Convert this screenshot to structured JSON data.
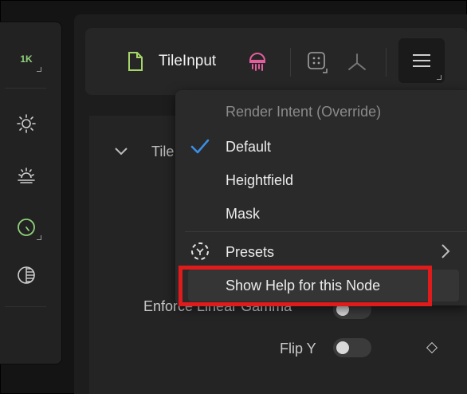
{
  "left_toolbar": {
    "resolution_badge": "1K",
    "tools": [
      "sun-icon",
      "sunrise-icon",
      "color-picker-icon",
      "half-circle-icon"
    ]
  },
  "node_header": {
    "title": "TileInput",
    "node_icon_color": "#a6d66a",
    "render_icon_color": "#e35d9d"
  },
  "section": {
    "title": "Tile",
    "props": [
      {
        "label": "Enforce Linear Gamma",
        "value": "off"
      },
      {
        "label": "Flip Y",
        "value": "off"
      }
    ]
  },
  "dropdown": {
    "heading": "Render Intent (Override)",
    "items": [
      {
        "label": "Default",
        "checked": true
      },
      {
        "label": "Heightfield",
        "checked": false
      },
      {
        "label": "Mask",
        "checked": false
      }
    ],
    "presets_label": "Presets",
    "help_label": "Show Help for this Node",
    "check_color": "#3b8fe6",
    "highlight_color": "#e01b1b"
  }
}
